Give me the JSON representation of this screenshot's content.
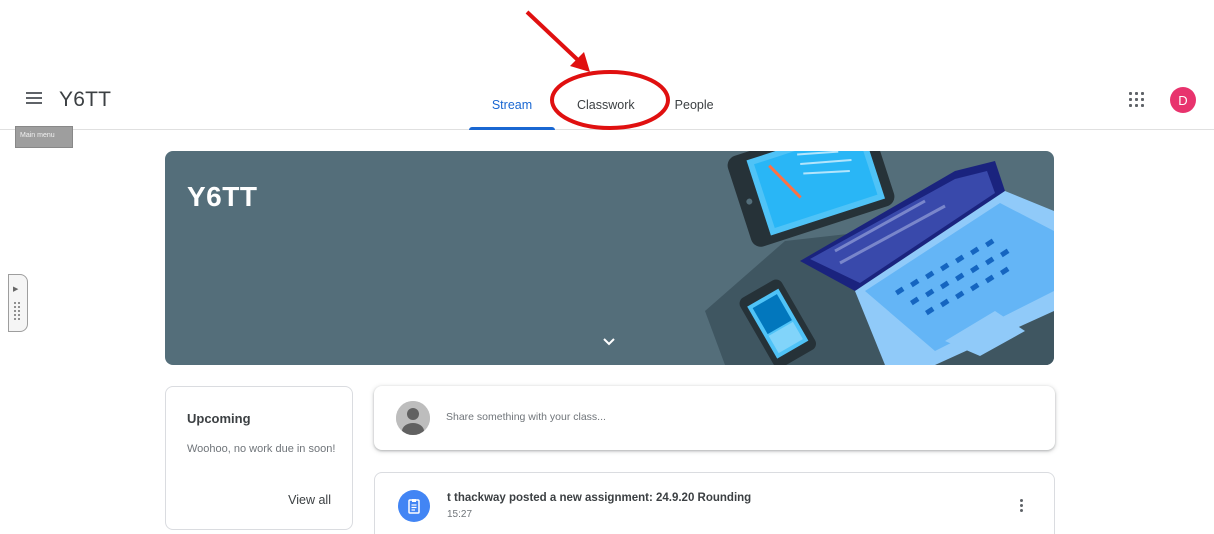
{
  "header": {
    "class_name": "Y6TT",
    "menu_icon": "hamburger-menu-icon",
    "tooltip": "Main menu",
    "tabs": [
      {
        "label": "Stream",
        "active": true
      },
      {
        "label": "Classwork",
        "active": false
      },
      {
        "label": "People",
        "active": false
      }
    ],
    "apps_icon": "apps-grid-icon",
    "avatar_letter": "D",
    "avatar_color": "#e8336d"
  },
  "banner": {
    "title": "Y6TT",
    "background_color": "#546e7a",
    "expand_icon": "chevron-down-icon"
  },
  "upcoming": {
    "title": "Upcoming",
    "message": "Woohoo, no work due in soon!",
    "view_all_label": "View all"
  },
  "share": {
    "placeholder": "Share something with your class..."
  },
  "posts": [
    {
      "title": "t thackway posted a new assignment: 24.9.20 Rounding",
      "time": "15:27",
      "icon": "assignment-icon",
      "icon_color": "#4285f4"
    }
  ],
  "colors": {
    "accent": "#1967d2",
    "annotation_red": "#e01010"
  }
}
